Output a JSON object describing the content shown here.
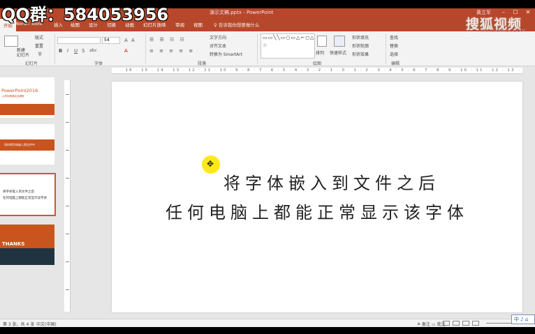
{
  "overlay": {
    "qq_text": "QQ群：584053956"
  },
  "watermark": {
    "brand": "搜狐视频",
    "sub": "TV.SOHU.COM"
  },
  "window": {
    "title": "演示文稿.pptx  -  PowerPoint",
    "user": "黄立军",
    "min": "–",
    "max": "☐",
    "close": "✕"
  },
  "tabs": {
    "items": [
      {
        "label": "开始",
        "active": true
      },
      {
        "label": "Nordri Tools"
      },
      {
        "label": "插入"
      },
      {
        "label": "绘图"
      },
      {
        "label": "设计"
      },
      {
        "label": "切换"
      },
      {
        "label": "动画"
      },
      {
        "label": "幻灯片放映"
      },
      {
        "label": "审阅"
      },
      {
        "label": "视图"
      }
    ],
    "tell_me": "♀ 告诉我你想要做什么"
  },
  "ribbon": {
    "new_slide": "新建\n幻灯片",
    "layout": "版式",
    "reset": "重置",
    "section": "节",
    "font_size": "54",
    "bold": "B",
    "italic": "I",
    "underline": "U",
    "strike": "S",
    "shadow": "abc",
    "text_direction": "文字方向",
    "align_text": "对齐文本",
    "smartart": "转换为 SmartArt",
    "arrange": "排列",
    "quick_styles": "快速样式",
    "shape_fill": "形状填充",
    "shape_outline": "形状轮廓",
    "shape_effects": "形状效果",
    "find": "查找",
    "replace": "替换",
    "select": "选择",
    "groups": {
      "slides": "幻灯片",
      "font": "字体",
      "paragraph": "段落",
      "drawing": "绘图",
      "editing": "编辑"
    },
    "shapes_glyphs": "▭▭╲╲▭○▭△⌐◻△↳⇦⇨⇧⇩✧⊂⊃{}☆"
  },
  "thumbs": [
    {
      "title": "PowerPoint2016",
      "sub": "从零到精通实战课程"
    },
    {
      "text": "如何将字体嵌入到文件中"
    },
    {
      "line1": "将字体嵌入到文件之后",
      "line2": "任何电脑上都能正常显示该字体"
    },
    {
      "text": "THANKS"
    }
  ],
  "ruler": {
    "marks": "· 16 · 15 · 14 · 13 · 12 · 11 · 10 · 9 · 8 · 7 · 6 · 5 · 4 · 3 · 2 · 1 · 0 · 1 · 2 · 3 · 4 · 5 · 6 · 7 · 8 · 9 · 10 · 11 · 12 · 13 · 14 · 15 · 16 ·"
  },
  "slide": {
    "line1": "将字体嵌入到文件之后",
    "line2": "任何电脑上都能正常显示该字体"
  },
  "status": {
    "slide_pos": "第 3 张，共 4 张",
    "language": "中文(中国)",
    "notes": "≙ 备注",
    "comments": "▭ 批注",
    "ime": "中 ♪ ⌂"
  },
  "colors": {
    "accent": "#b7472a",
    "thumb_bar": "#c9541e",
    "thanks_bg": "#1f3340"
  }
}
